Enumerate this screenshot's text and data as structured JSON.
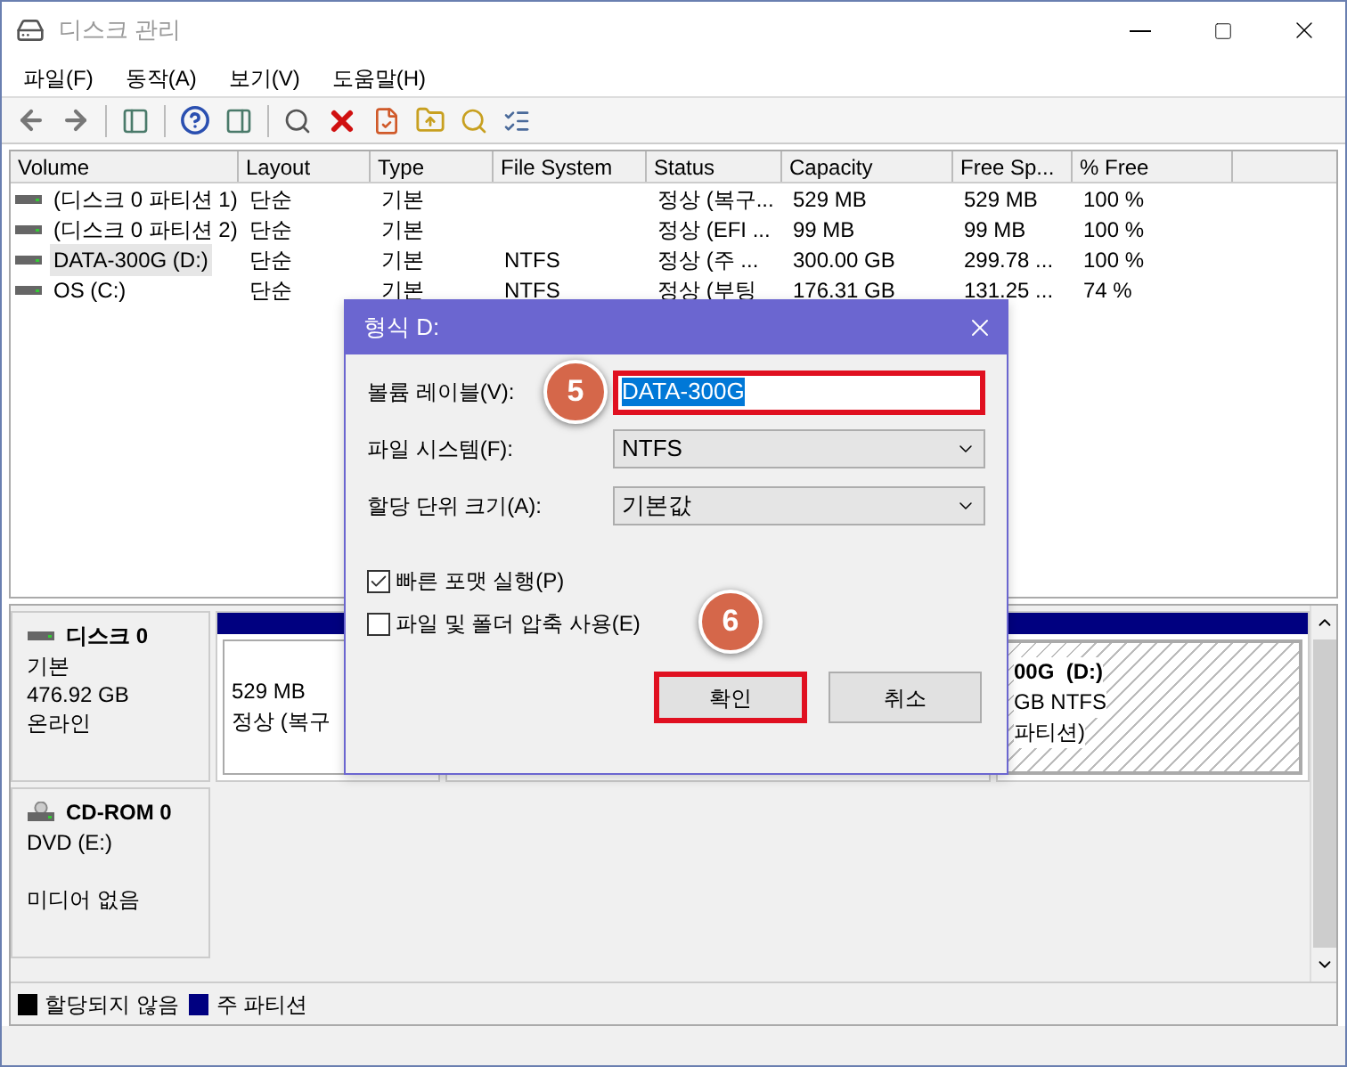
{
  "window": {
    "title": "디스크 관리"
  },
  "menu": [
    "파일(F)",
    "동작(A)",
    "보기(V)",
    "도움말(H)"
  ],
  "table": {
    "columns": [
      "Volume",
      "Layout",
      "Type",
      "File System",
      "Status",
      "Capacity",
      "Free Sp...",
      "% Free"
    ],
    "rows": [
      {
        "cells": [
          "(디스크 0 파티션 1)",
          "단순",
          "기본",
          "",
          "정상 (복구...",
          "529 MB",
          "529 MB",
          "100 %"
        ],
        "selected": false
      },
      {
        "cells": [
          "(디스크 0 파티션 2)",
          "단순",
          "기본",
          "",
          "정상 (EFI ...",
          "99 MB",
          "99 MB",
          "100 %"
        ],
        "selected": false
      },
      {
        "cells": [
          "DATA-300G (D:)",
          "단순",
          "기본",
          "NTFS",
          "정상 (주 ...",
          "300.00 GB",
          "299.78 ...",
          "100 %"
        ],
        "selected": true
      },
      {
        "cells": [
          "OS (C:)",
          "단순",
          "기본",
          "NTFS",
          "정상 (부팅",
          "176.31 GB",
          "131.25 ...",
          "74 %"
        ],
        "selected": false
      }
    ]
  },
  "disks": [
    {
      "kind": "disk",
      "name": "디스크 0",
      "lines": [
        "기본",
        "476.92 GB",
        "온라인"
      ],
      "partitions": [
        {
          "kind": "primary",
          "lines": [
            "529 MB",
            "정상 (복구"
          ]
        },
        {
          "kind": "covered"
        },
        {
          "kind": "hatched",
          "lines": [
            "00G  (D:)",
            "GB NTFS",
            "파티션)"
          ]
        }
      ]
    },
    {
      "kind": "cdrom",
      "name": "CD-ROM 0",
      "lines": [
        "DVD (E:)",
        "미디어 없음"
      ]
    }
  ],
  "legend": [
    {
      "label": "할당되지 않음",
      "color": "#000000"
    },
    {
      "label": "주 파티션",
      "color": "#000080"
    }
  ],
  "dialog": {
    "title": "형식 D:",
    "fields": [
      {
        "kind": "text",
        "label": "볼륨 레이블(V):",
        "value": "DATA-300G",
        "badge": "5"
      },
      {
        "kind": "select",
        "label": "파일 시스템(F):",
        "value": "NTFS"
      },
      {
        "kind": "select",
        "label": "할당 단위 크기(A):",
        "value": "기본값"
      }
    ],
    "checkboxes": [
      {
        "label": "빠른 포맷 실행(P)",
        "checked": true
      },
      {
        "label": "파일 및 폴더 압축 사용(E)",
        "checked": false
      }
    ],
    "buttons": [
      {
        "label": "확인",
        "highlighted": true,
        "badge": "6"
      },
      {
        "label": "취소",
        "highlighted": false
      }
    ]
  }
}
